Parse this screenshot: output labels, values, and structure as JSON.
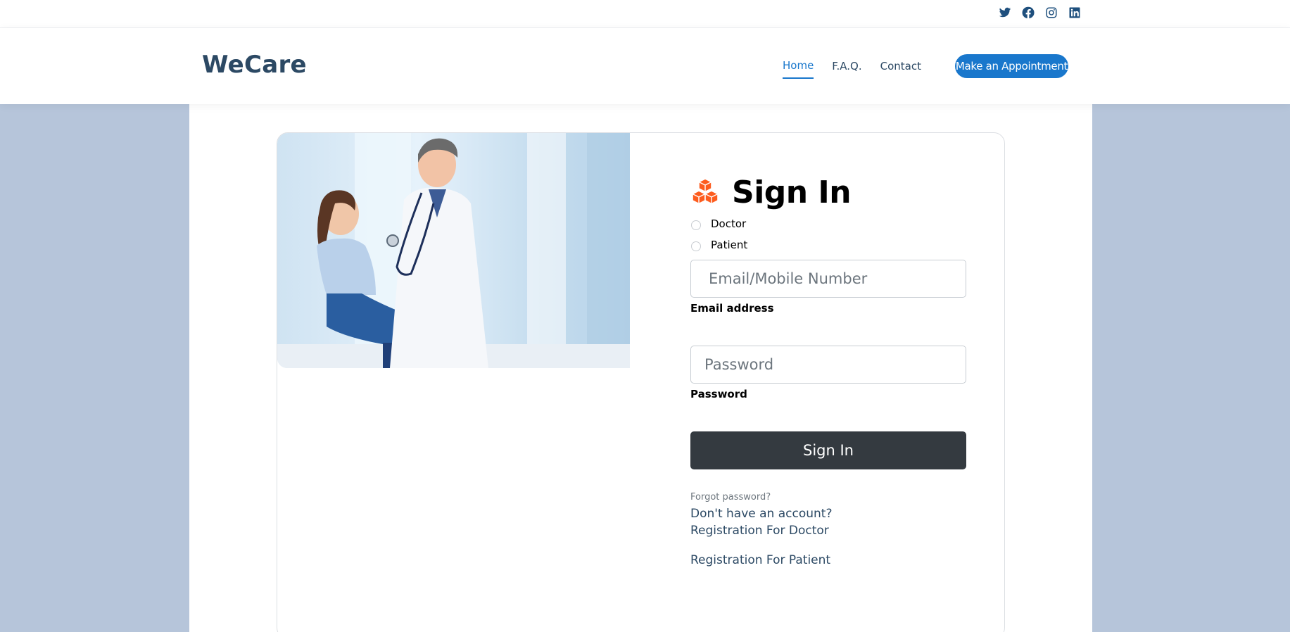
{
  "social": {
    "icons": [
      "twitter-icon",
      "facebook-icon",
      "instagram-icon",
      "linkedin-icon"
    ],
    "color": "#1e4f7d"
  },
  "header": {
    "logo": "WeCare",
    "nav": [
      {
        "label": "Home",
        "active": true
      },
      {
        "label": "F.A.Q.",
        "active": false
      },
      {
        "label": "Contact",
        "active": false
      }
    ],
    "appointment_label": "Make an Appointment",
    "accent": "#1977cc"
  },
  "signin": {
    "icon": "cubes-icon",
    "icon_color": "#fd5c1e",
    "title": "Sign In",
    "roles": [
      "Doctor",
      "Patient"
    ],
    "email_placeholder": "Email/Mobile Number",
    "email_label": "Email address",
    "password_placeholder": "Password",
    "password_label": "Password",
    "button_label": "Sign In",
    "forgot_label": "Forgot password?",
    "no_account_label": "Don't have an account?",
    "register_doctor_label": "Registration For Doctor",
    "register_patient_label": "Registration For Patient"
  },
  "colors": {
    "page_background": "#b6c5da",
    "button_dark": "#343a40",
    "text_dark": "#2c4964"
  }
}
